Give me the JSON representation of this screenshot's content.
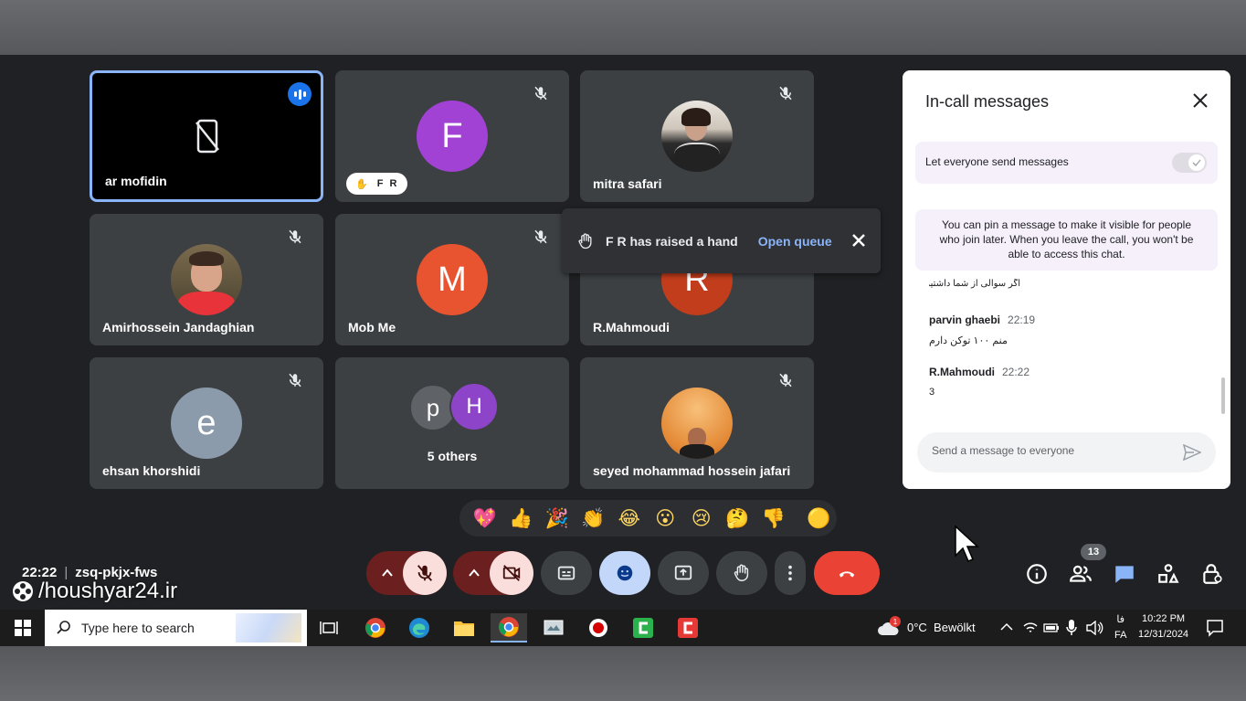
{
  "participants": [
    {
      "name": "ar mofidin",
      "type": "screen",
      "speaking": true
    },
    {
      "name": "",
      "initial": "F",
      "color": "#a142d4",
      "badge": "F R",
      "muted": true
    },
    {
      "name": "mitra safari",
      "type": "photo",
      "muted": true
    },
    {
      "name": "Amirhossein Jandaghian",
      "type": "photo",
      "muted": true
    },
    {
      "name": "Mob Me",
      "initial": "M",
      "color": "#e8542f",
      "muted": true
    },
    {
      "name": "R.Mahmoudi",
      "initial": "R",
      "color": "#c23d1b",
      "muted": true
    },
    {
      "name": "ehsan khorshidi",
      "initial": "e",
      "color": "#8b9bab",
      "muted": true
    },
    {
      "name": "5 others",
      "initials": [
        "p",
        "H"
      ],
      "colors": [
        "#5f6368",
        "#8e44c9"
      ]
    },
    {
      "name": "seyed mohammad hossein jafari",
      "type": "photo",
      "muted": true
    }
  ],
  "toast": {
    "text": "F R has raised a hand",
    "action": "Open queue"
  },
  "chat_panel": {
    "title": "In-call messages",
    "setting_label": "Let everyone send messages",
    "setting_enabled": true,
    "info": "You can pin a message to make it visible for people who join later. When you leave the call, you won't be able to access this chat.",
    "truncated_message": "اگر سوالی از شما داشتیم باید چیکار کنیم؟",
    "messages": [
      {
        "sender": "parvin ghaebi",
        "time": "22:19",
        "text": "منم ۱۰۰ توکن دارم"
      },
      {
        "sender": "R.Mahmoudi",
        "time": "22:22",
        "text": "3"
      }
    ],
    "compose_placeholder": "Send a message to everyone"
  },
  "reactions": [
    "💖",
    "👍",
    "🎉",
    "👏",
    "😂",
    "😮",
    "😢",
    "🤔",
    "👎",
    "🟡"
  ],
  "meeting": {
    "time": "22:22",
    "code": "zsq-pkjx-fws"
  },
  "watermark": "/houshyar24.ir",
  "people_count": "13",
  "taskbar": {
    "search_placeholder": "Type here to search",
    "weather": "0°C  Bewölkt",
    "lang_top": "فا",
    "lang_bottom": "FA",
    "clock_time": "10:22 PM",
    "clock_date": "12/31/2024",
    "weather_badge": "1"
  },
  "colors": {
    "meet_bg": "#202124",
    "tile_bg": "#3c4043",
    "end_call": "#ea4335",
    "accent": "#8ab4f8"
  }
}
